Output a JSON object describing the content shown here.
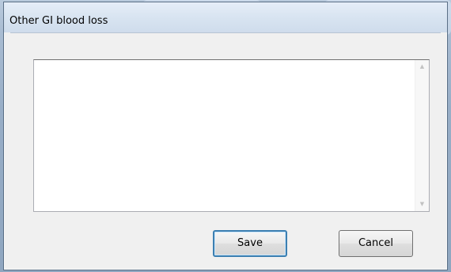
{
  "window": {
    "title": "Other GI blood loss"
  },
  "textbox": {
    "value": ""
  },
  "buttons": {
    "save_label": "Save",
    "cancel_label": "Cancel"
  },
  "icons": {
    "scroll_up": "scroll-up-arrow-icon",
    "scroll_down": "scroll-down-arrow-icon"
  },
  "colors": {
    "default_button_border": "#3c7fb1",
    "window_background": "#f0f0f0"
  }
}
